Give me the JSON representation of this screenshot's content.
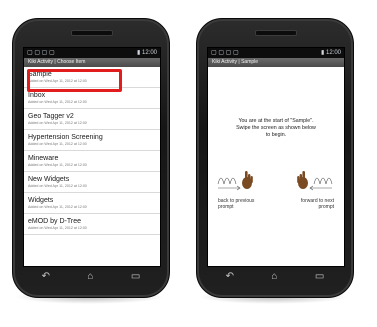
{
  "left_phone": {
    "status": {
      "left": "▢ ▢ ▢ ▢",
      "right": "▮ 12:00"
    },
    "title_bar": "Kiki Activity | Choose Item",
    "items": [
      {
        "title": "Sample",
        "subtitle": "Added on Wed Apr 11, 2012 at 12:00"
      },
      {
        "title": "Inbox",
        "subtitle": "Added on Wed Apr 11, 2012 at 12:00"
      },
      {
        "title": "Geo Tagger v2",
        "subtitle": "Added on Wed Apr 11, 2012 at 12:00"
      },
      {
        "title": "Hypertension Screening",
        "subtitle": "Added on Wed Apr 11, 2012 at 12:00"
      },
      {
        "title": "Mineware",
        "subtitle": "Added on Wed Apr 11, 2012 at 12:00"
      },
      {
        "title": "New Widgets",
        "subtitle": "Added on Wed Apr 11, 2012 at 12:00"
      },
      {
        "title": "Widgets",
        "subtitle": "Added on Wed Apr 11, 2012 at 12:00"
      },
      {
        "title": "eMOD by D-Tree",
        "subtitle": "Added on Wed Apr 11, 2012 at 12:00"
      }
    ],
    "nav": {
      "back": "↶",
      "home": "⌂",
      "recent": "▭"
    }
  },
  "right_phone": {
    "status": {
      "left": "▢ ▢ ▢ ▢",
      "right": "▮ 12:00"
    },
    "title_bar": "Kiki Activity | Sample",
    "instruction_line1": "You are at the start of \"Sample\".",
    "instruction_line2": "Swipe the screen as shown below",
    "instruction_line3": "to begin.",
    "back_hint": "back to previous prompt",
    "forward_hint": "forward to next prompt",
    "nav": {
      "back": "↶",
      "home": "⌂",
      "recent": "▭"
    }
  },
  "colors": {
    "highlight": "#e11d1d",
    "phone_body": "#1c1c1c",
    "title_bar": "#555555"
  }
}
